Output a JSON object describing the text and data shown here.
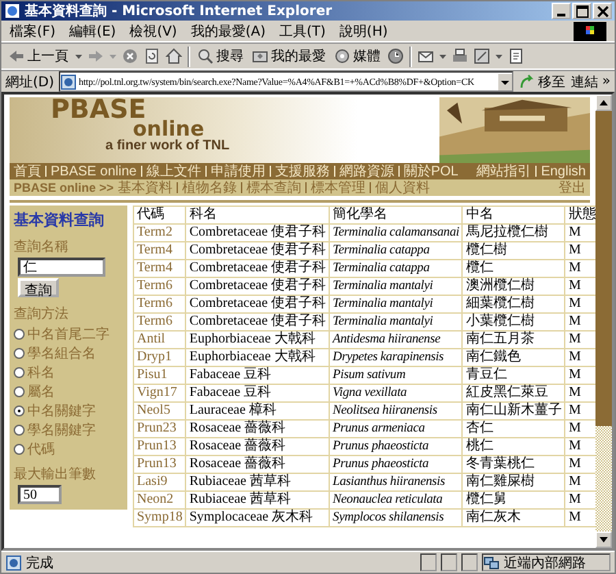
{
  "window": {
    "title": "基本資料查詢 - Microsoft Internet Explorer"
  },
  "menu": [
    "檔案(F)",
    "編輯(E)",
    "檢視(V)",
    "我的最愛(A)",
    "工具(T)",
    "說明(H)"
  ],
  "toolbar": {
    "back": "上一頁",
    "search": "搜尋",
    "favorites": "我的最愛",
    "media": "媒體"
  },
  "address": {
    "label": "網址(D)",
    "value": "http://pol.tnl.org.tw/system/bin/search.exe?Name?Value=%A4%AF&B1=+%ACd%B8%DF+&Option=CK",
    "go": "移至",
    "links": "連結",
    "more": "»"
  },
  "banner": {
    "logo_line1": "PBASE",
    "logo_line2": "online",
    "tagline": "a finer work of TNL"
  },
  "nav": {
    "items": [
      "首頁",
      "PBASE online",
      "線上文件",
      "申請使用",
      "支援服務",
      "網路資源",
      "關於POL"
    ],
    "right": [
      "網站指引",
      "English"
    ]
  },
  "breadcrumb": {
    "root": "PBASE online >>",
    "items": [
      "基本資料",
      "植物名錄",
      "標本查詢",
      "標本管理",
      "個人資料"
    ],
    "logout": "登出"
  },
  "search_panel": {
    "title": "基本資料查詢",
    "name_label": "查詢名稱",
    "name_value": "仁",
    "submit": "查詢",
    "method_label": "查詢方法",
    "methods": [
      {
        "label": "中名首尾二字",
        "selected": false
      },
      {
        "label": "學名組合名",
        "selected": false
      },
      {
        "label": "科名",
        "selected": false
      },
      {
        "label": "屬名",
        "selected": false
      },
      {
        "label": "中名關鍵字",
        "selected": true
      },
      {
        "label": "學名關鍵字",
        "selected": false
      },
      {
        "label": "代碼",
        "selected": false
      }
    ],
    "max_label": "最大輸出筆數",
    "max_value": "50"
  },
  "table": {
    "columns": [
      "代碼",
      "科名",
      "簡化學名",
      "中名",
      "狀態"
    ],
    "rows": [
      {
        "code": "Term2",
        "family": "Combretaceae 使君子科",
        "scientific_name": "Terminalia calamansanai",
        "chinese_name": "馬尼拉欖仁樹",
        "status": "M"
      },
      {
        "code": "Term4",
        "family": "Combretaceae 使君子科",
        "scientific_name": "Terminalia catappa",
        "chinese_name": "欖仁樹",
        "status": "M"
      },
      {
        "code": "Term4",
        "family": "Combretaceae 使君子科",
        "scientific_name": "Terminalia catappa",
        "chinese_name": "欖仁",
        "status": "M"
      },
      {
        "code": "Term6",
        "family": "Combretaceae 使君子科",
        "scientific_name": "Terminalia mantalyi",
        "chinese_name": "澳洲欖仁樹",
        "status": "M"
      },
      {
        "code": "Term6",
        "family": "Combretaceae 使君子科",
        "scientific_name": "Terminalia mantalyi",
        "chinese_name": "細葉欖仁樹",
        "status": "M"
      },
      {
        "code": "Term6",
        "family": "Combretaceae 使君子科",
        "scientific_name": "Terminalia mantalyi",
        "chinese_name": "小葉欖仁樹",
        "status": "M"
      },
      {
        "code": "Antil",
        "family": "Euphorbiaceae 大戟科",
        "scientific_name": "Antidesma hiiranense",
        "chinese_name": "南仁五月茶",
        "status": "M"
      },
      {
        "code": "Dryp1",
        "family": "Euphorbiaceae 大戟科",
        "scientific_name": "Drypetes karapinensis",
        "chinese_name": "南仁鐵色",
        "status": "M"
      },
      {
        "code": "Pisu1",
        "family": "Fabaceae 豆科",
        "scientific_name": "Pisum sativum",
        "chinese_name": "青豆仁",
        "status": "M"
      },
      {
        "code": "Vign17",
        "family": "Fabaceae 豆科",
        "scientific_name": "Vigna vexillata",
        "chinese_name": "紅皮黑仁萊豆",
        "status": "M"
      },
      {
        "code": "Neol5",
        "family": "Lauraceae 樟科",
        "scientific_name": "Neolitsea hiiranensis",
        "chinese_name": "南仁山新木薑子",
        "status": "M"
      },
      {
        "code": "Prun23",
        "family": "Rosaceae 薔薇科",
        "scientific_name": "Prunus armeniaca",
        "chinese_name": "杏仁",
        "status": "M"
      },
      {
        "code": "Prun13",
        "family": "Rosaceae 薔薇科",
        "scientific_name": "Prunus phaeosticta",
        "chinese_name": "桃仁",
        "status": "M"
      },
      {
        "code": "Prun13",
        "family": "Rosaceae 薔薇科",
        "scientific_name": "Prunus phaeosticta",
        "chinese_name": "冬青葉桃仁",
        "status": "M"
      },
      {
        "code": "Lasi9",
        "family": "Rubiaceae 茜草科",
        "scientific_name": "Lasianthus hiiranensis",
        "chinese_name": "南仁雞屎樹",
        "status": "M"
      },
      {
        "code": "Neon2",
        "family": "Rubiaceae 茜草科",
        "scientific_name": "Neonauclea reticulata",
        "chinese_name": "欖仁舅",
        "status": "M"
      },
      {
        "code": "Symp18",
        "family": "Symplocaceae 灰木科",
        "scientific_name": "Symplocos shilanensis",
        "chinese_name": "南仁灰木",
        "status": "M"
      }
    ]
  },
  "status_bar": {
    "text": "完成",
    "zone": "近端內部網路"
  }
}
